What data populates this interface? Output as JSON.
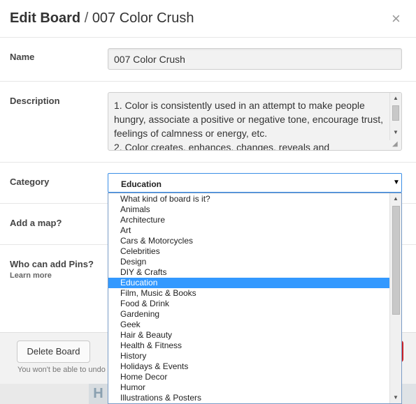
{
  "header": {
    "title_bold": "Edit Board",
    "separator": "/",
    "board_name": "007 Color Crush",
    "close_glyph": "×"
  },
  "form": {
    "name_label": "Name",
    "name_value": "007 Color Crush",
    "description_label": "Description",
    "description_value": "1. Color is consistently used in an attempt to make people hungry, associate a positive or negative tone, encourage trust, feelings of calmness or energy, etc.\n2. Color creates, enhances, changes, reveals and",
    "category_label": "Category",
    "category_value": "Education",
    "map_label": "Add a map?",
    "who_label": "Who can add Pins?",
    "learn_more": "Learn more"
  },
  "category_options": [
    "What kind of board is it?",
    "Animals",
    "Architecture",
    "Art",
    "Cars & Motorcycles",
    "Celebrities",
    "Design",
    "DIY & Crafts",
    "Education",
    "Film, Music & Books",
    "Food & Drink",
    "Gardening",
    "Geek",
    "Hair & Beauty",
    "Health & Fitness",
    "History",
    "Holidays & Events",
    "Home Decor",
    "Humor",
    "Illustrations & Posters"
  ],
  "selected_option": "Education",
  "footer": {
    "delete_label": "Delete Board",
    "warning_text": "You won't be able to undo"
  },
  "colors": {
    "selected_bg": "#3399ff",
    "focus_border": "#3a8ee6",
    "danger": "#c92228"
  },
  "icons": {
    "close": "close-icon",
    "dropdown": "chevron-down-icon",
    "resize": "resize-handle-icon"
  }
}
